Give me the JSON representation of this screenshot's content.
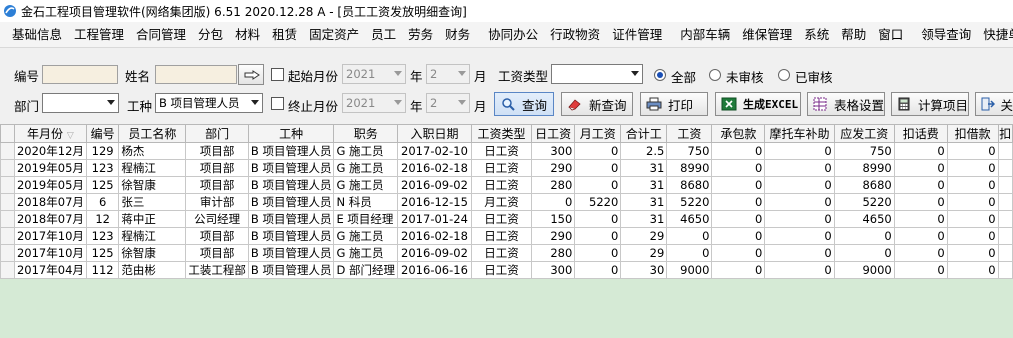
{
  "window": {
    "title": "金石工程项目管理软件(网络集团版) 6.51  2020.12.28 A - [员工工资发放明细查询]"
  },
  "menu": {
    "items": [
      "基础信息",
      "工程管理",
      "合同管理",
      "分包",
      "材料",
      "租赁",
      "固定资产",
      "员工",
      "劳务",
      "财务",
      "协同办公",
      "行政物资",
      "证件管理",
      "内部车辆",
      "维保管理",
      "系统",
      "帮助",
      "窗口",
      "领导查询",
      "快捷单据"
    ]
  },
  "filters": {
    "id_label": "编号",
    "name_label": "姓名",
    "start_month_label": "起始月份",
    "start_year": "2021",
    "year_unit": "年",
    "start_month": "2",
    "month_unit": "月",
    "wage_type_label": "工资类型",
    "wage_type_value": "",
    "radio_all": "全部",
    "radio_unreviewed": "未审核",
    "radio_reviewed": "已审核",
    "dept_label": "部门",
    "dept_value": "",
    "worktype_label": "工种",
    "worktype_value": "B 项目管理人员",
    "end_month_label": "终止月份",
    "end_year": "2021",
    "end_month": "2"
  },
  "toolbar": {
    "query": "查询",
    "new_query": "新查询",
    "print": "打印",
    "excel": "生成EXCEL",
    "table_settings": "表格设置",
    "calc_wage": "计算项目",
    "close": "关"
  },
  "table": {
    "columns": [
      "年月份",
      "编号",
      "员工名称",
      "部门",
      "工种",
      "职务",
      "入职日期",
      "工资类型",
      "日工资",
      "月工资",
      "合计工",
      "工资",
      "承包款",
      "摩托车补助",
      "应发工资",
      "扣话费",
      "扣借款",
      "扣"
    ],
    "rows": [
      [
        "2020年12月",
        "129",
        "杨杰",
        "项目部",
        "B 项目管理人员",
        "G 施工员",
        "2017-02-10",
        "日工资",
        "300",
        "0",
        "2.5",
        "750",
        "0",
        "0",
        "750",
        "0",
        "0"
      ],
      [
        "2019年05月",
        "123",
        "程楠江",
        "项目部",
        "B 项目管理人员",
        "G 施工员",
        "2016-02-18",
        "日工资",
        "290",
        "0",
        "31",
        "8990",
        "0",
        "0",
        "8990",
        "0",
        "0"
      ],
      [
        "2019年05月",
        "125",
        "徐智康",
        "项目部",
        "B 项目管理人员",
        "G 施工员",
        "2016-09-02",
        "日工资",
        "280",
        "0",
        "31",
        "8680",
        "0",
        "0",
        "8680",
        "0",
        "0"
      ],
      [
        "2018年07月",
        "6",
        "张三",
        "审计部",
        "B 项目管理人员",
        "N 科员",
        "2016-12-15",
        "月工资",
        "0",
        "5220",
        "31",
        "5220",
        "0",
        "0",
        "5220",
        "0",
        "0"
      ],
      [
        "2018年07月",
        "12",
        "蒋中正",
        "公司经理",
        "B 项目管理人员",
        "E 项目经理",
        "2017-01-24",
        "日工资",
        "150",
        "0",
        "31",
        "4650",
        "0",
        "0",
        "4650",
        "0",
        "0"
      ],
      [
        "2017年10月",
        "123",
        "程楠江",
        "项目部",
        "B 项目管理人员",
        "G 施工员",
        "2016-02-18",
        "日工资",
        "290",
        "0",
        "29",
        "0",
        "0",
        "0",
        "0",
        "0",
        "0"
      ],
      [
        "2017年10月",
        "125",
        "徐智康",
        "项目部",
        "B 项目管理人员",
        "G 施工员",
        "2016-09-02",
        "日工资",
        "280",
        "0",
        "29",
        "0",
        "0",
        "0",
        "0",
        "0",
        "0"
      ],
      [
        "2017年04月",
        "112",
        "范由彬",
        "工装工程部",
        "B 项目管理人员",
        "D 部门经理",
        "2016-06-16",
        "日工资",
        "300",
        "0",
        "30",
        "9000",
        "0",
        "0",
        "9000",
        "0",
        "0"
      ]
    ]
  }
}
